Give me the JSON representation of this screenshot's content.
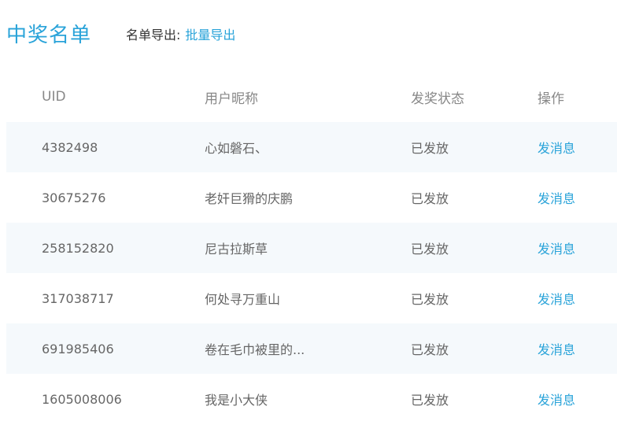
{
  "header": {
    "title": "中奖名单",
    "export_label": "名单导出:",
    "export_link": "批量导出"
  },
  "table": {
    "columns": [
      "UID",
      "用户昵称",
      "发奖状态",
      "操作"
    ],
    "rows": [
      {
        "uid": "4382498",
        "nickname": "心如磐石、",
        "status": "已发放",
        "action": "发消息"
      },
      {
        "uid": "30675276",
        "nickname": "老奸巨猾的庆鹏",
        "status": "已发放",
        "action": "发消息"
      },
      {
        "uid": "258152820",
        "nickname": "尼古拉斯草",
        "status": "已发放",
        "action": "发消息"
      },
      {
        "uid": "317038717",
        "nickname": "何处寻万重山",
        "status": "已发放",
        "action": "发消息"
      },
      {
        "uid": "691985406",
        "nickname": "卷在毛巾被里的...",
        "status": "已发放",
        "action": "发消息"
      },
      {
        "uid": "1605008006",
        "nickname": "我是小大侠",
        "status": "已发放",
        "action": "发消息"
      }
    ]
  }
}
